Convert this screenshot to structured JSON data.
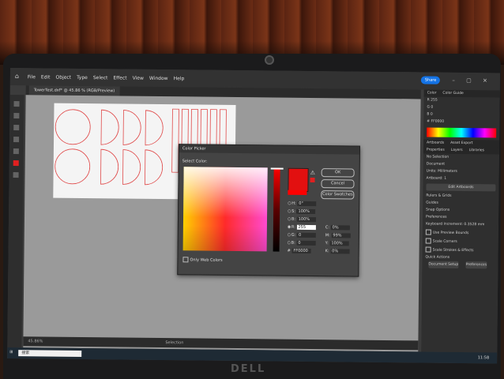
{
  "menubar": {
    "items": [
      "File",
      "Edit",
      "Object",
      "Type",
      "Select",
      "Effect",
      "View",
      "Window",
      "Help"
    ],
    "share_label": "Share"
  },
  "document_tab": "TowerTest.dxf* @ 45.86 % (RGB/Preview)",
  "color_panel": {
    "tabs": [
      "Color",
      "Color Guide"
    ],
    "r": "255",
    "g": "0",
    "b": "0",
    "hex": "FF0000"
  },
  "artboards_panel": {
    "tabs": [
      "Artboards",
      "Asset Export"
    ]
  },
  "properties_panel": {
    "tabs": [
      "Properties",
      "Layers",
      "Libraries"
    ],
    "no_selection": "No Selection",
    "document": "Document",
    "units_label": "Units:",
    "units_value": "Millimeters",
    "artboard_label": "Artboard:",
    "artboard_value": "1",
    "edit_artboards": "Edit Artboards",
    "rulers_grids": "Rulers & Grids",
    "guides": "Guides",
    "snap_options": "Snap Options",
    "preferences_title": "Preferences",
    "keyboard_increment_label": "Keyboard Increment:",
    "keyboard_increment_value": "0.3528 mm",
    "use_preview_bounds": "Use Preview Bounds",
    "scale_corners": "Scale Corners",
    "scale_strokes": "Scale Strokes & Effects",
    "quick_actions": "Quick Actions",
    "document_setup": "Document Setup",
    "preferences_btn": "Preferences"
  },
  "color_picker": {
    "title": "Color Picker",
    "select_color": "Select Color:",
    "ok": "OK",
    "cancel": "Cancel",
    "swatches": "Color Swatches",
    "only_web": "Only Web Colors",
    "h_label": "H:",
    "h_value": "0°",
    "s_label": "S:",
    "s_value": "100%",
    "b_label": "B:",
    "b_value": "100%",
    "r_label": "R:",
    "r_value": "255",
    "g_label": "G:",
    "g_value": "0",
    "bb_label": "B:",
    "bb_value": "0",
    "c_label": "C:",
    "c_value": "0%",
    "m_label": "M:",
    "m_value": "99%",
    "y_label": "Y:",
    "y_value": "100%",
    "k_label": "K:",
    "k_value": "0%",
    "hex_label": "#",
    "hex_value": "FF0000"
  },
  "statusbar": {
    "zoom": "45.86%",
    "selection": "Selection"
  },
  "taskbar": {
    "search_placeholder": "搜索",
    "clock": "11:58"
  },
  "brand": "DELL",
  "colors": {
    "accent": "#1473e6",
    "picked": "#ff0000",
    "shape_stroke": "#e04a4a"
  }
}
